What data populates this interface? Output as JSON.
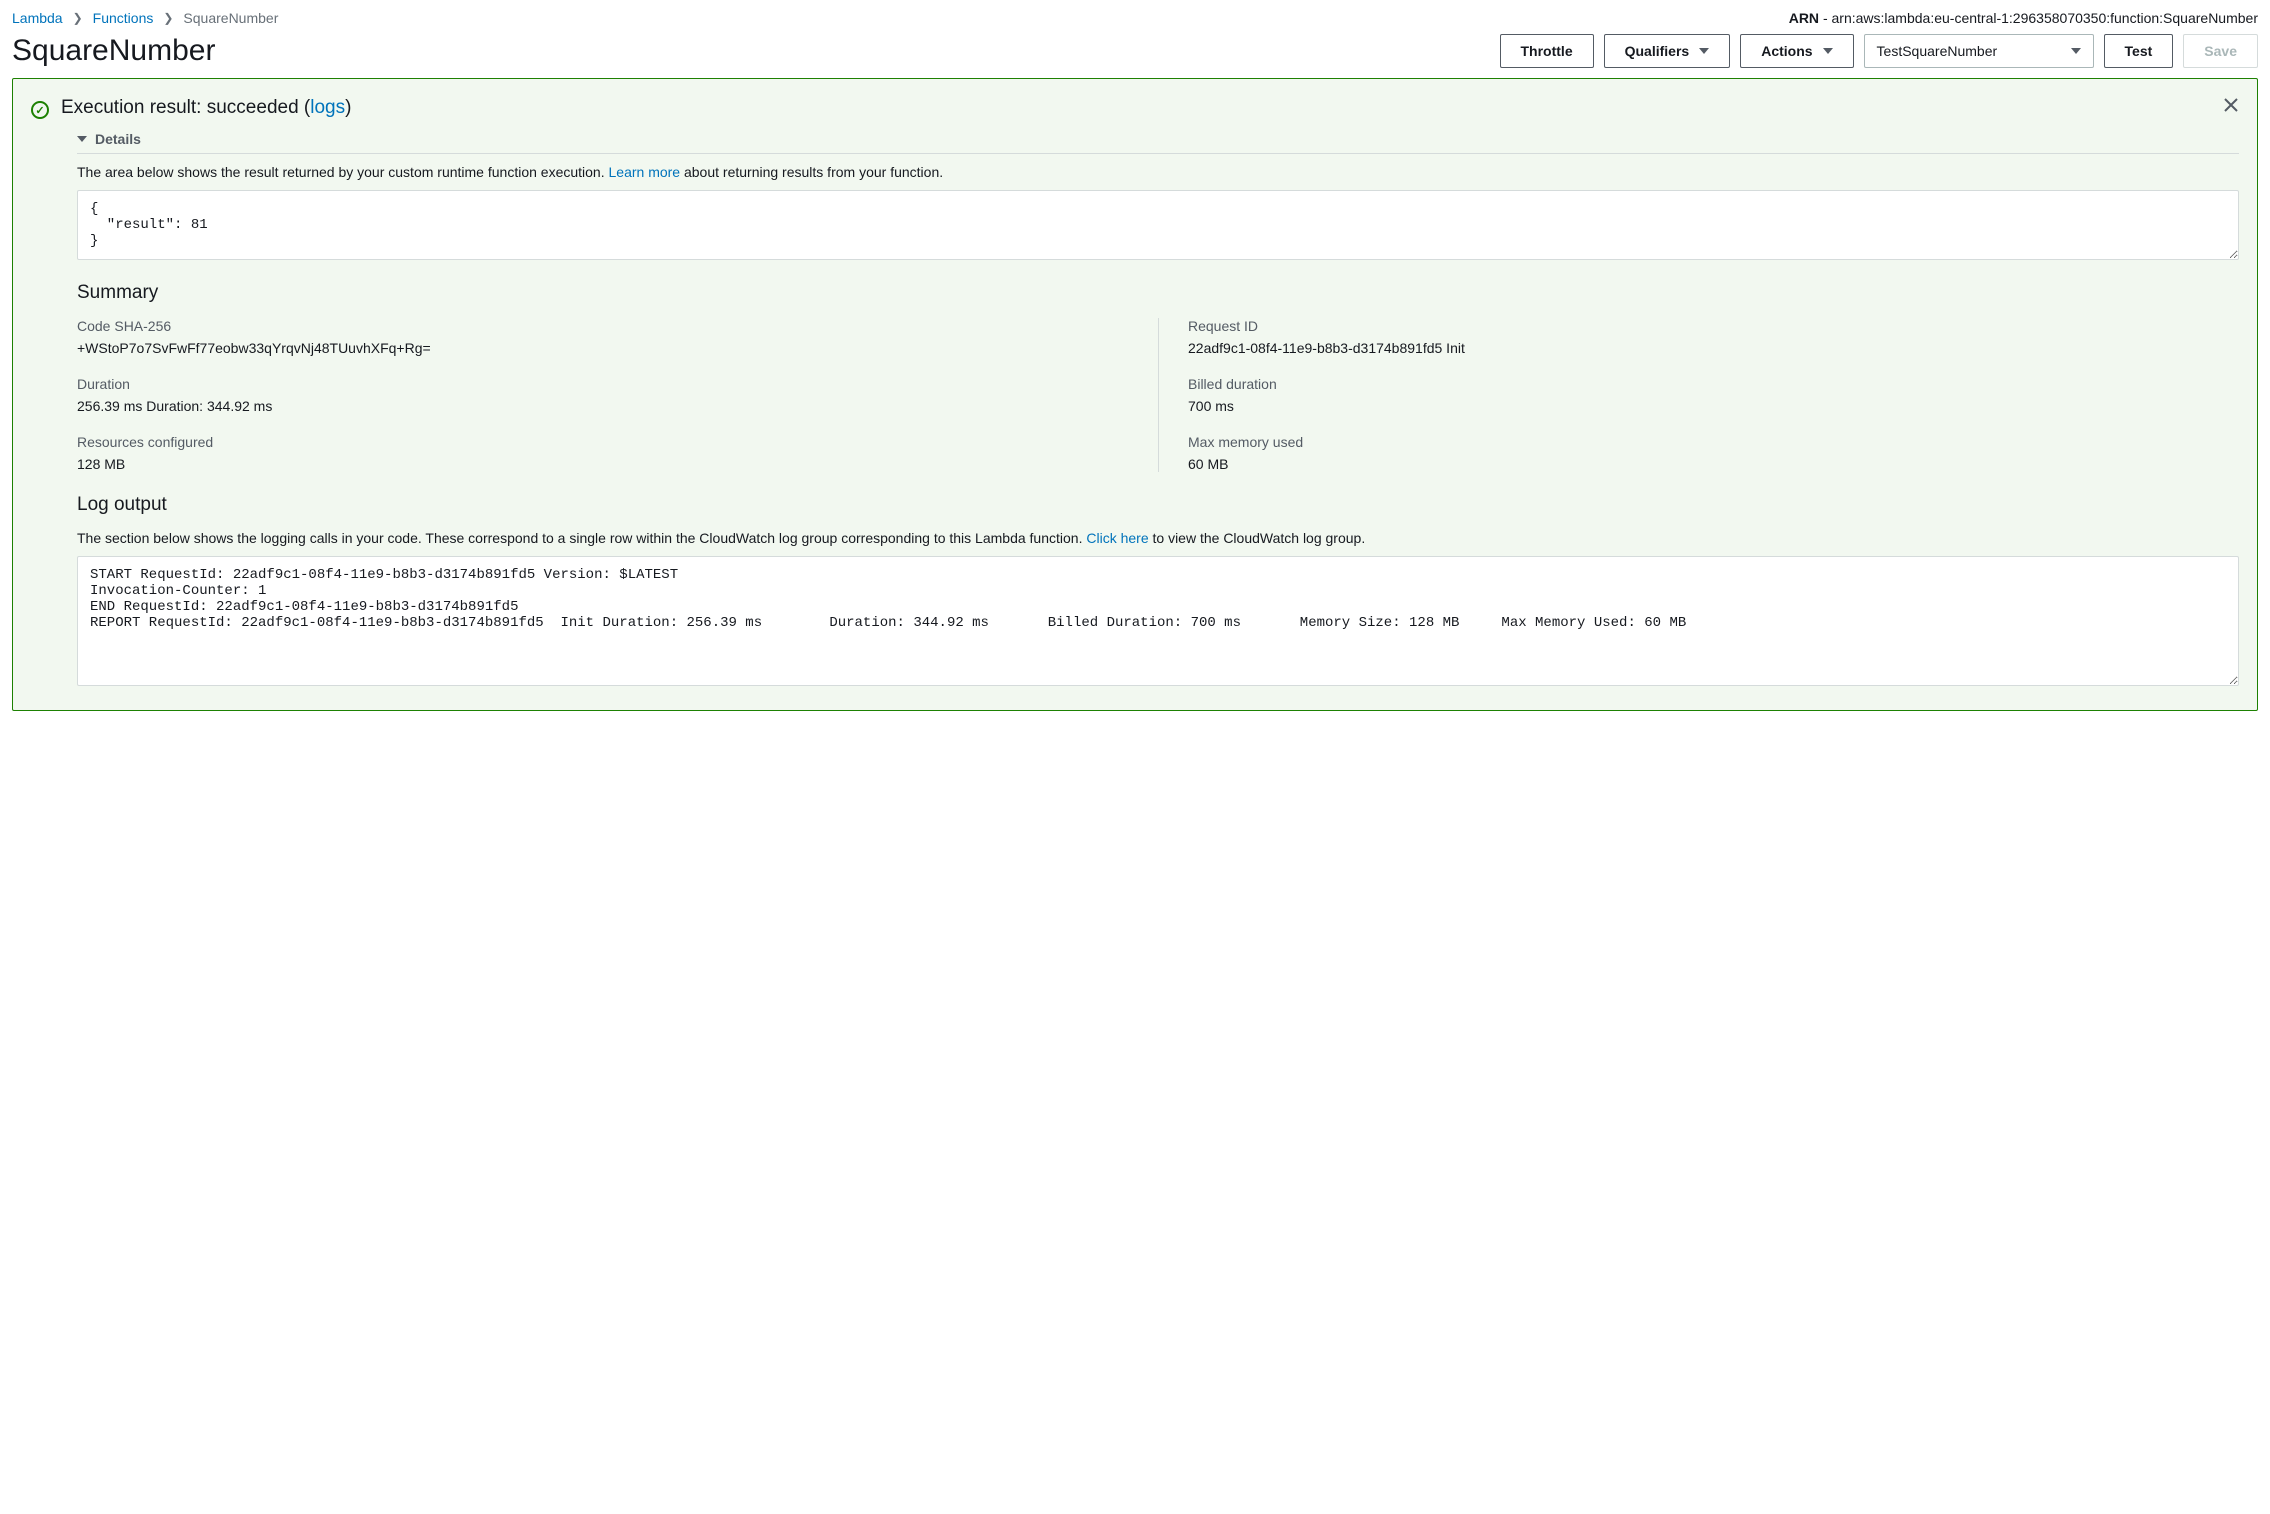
{
  "breadcrumbs": {
    "lambda": "Lambda",
    "functions": "Functions",
    "current": "SquareNumber"
  },
  "arn": {
    "label": "ARN",
    "value": "arn:aws:lambda:eu-central-1:296358070350:function:SquareNumber"
  },
  "title": "SquareNumber",
  "toolbar": {
    "throttle": "Throttle",
    "qualifiers": "Qualifiers",
    "actions": "Actions",
    "test_event": "TestSquareNumber",
    "test": "Test",
    "save": "Save"
  },
  "result": {
    "heading_prefix": "Execution result: succeeded (",
    "logs_link": "logs",
    "heading_suffix": ")",
    "details_label": "Details",
    "description_before": "The area below shows the result returned by your custom runtime function execution. ",
    "learn_more": "Learn more",
    "description_after": " about returning results from your function.",
    "payload": "{\n  \"result\": 81\n}"
  },
  "summary": {
    "heading": "Summary",
    "code_sha_label": "Code SHA-256",
    "code_sha_value": "+WStoP7o7SvFwFf77eobw33qYrqvNj48TUuvhXFq+Rg=",
    "request_id_label": "Request ID",
    "request_id_value": "22adf9c1-08f4-11e9-b8b3-d3174b891fd5 Init",
    "duration_label": "Duration",
    "duration_value": "256.39 ms Duration: 344.92 ms",
    "billed_label": "Billed duration",
    "billed_value": "700 ms",
    "resources_label": "Resources configured",
    "resources_value": "128 MB",
    "max_mem_label": "Max memory used",
    "max_mem_value": "60 MB"
  },
  "log": {
    "heading": "Log output",
    "description_before": "The section below shows the logging calls in your code. These correspond to a single row within the CloudWatch log group corresponding to this Lambda function. ",
    "click_here": "Click here",
    "description_after": " to view the CloudWatch log group.",
    "content": "START RequestId: 22adf9c1-08f4-11e9-b8b3-d3174b891fd5 Version: $LATEST\nInvocation-Counter: 1\nEND RequestId: 22adf9c1-08f4-11e9-b8b3-d3174b891fd5\nREPORT RequestId: 22adf9c1-08f4-11e9-b8b3-d3174b891fd5  Init Duration: 256.39 ms        Duration: 344.92 ms       Billed Duration: 700 ms       Memory Size: 128 MB     Max Memory Used: 60 MB"
  }
}
